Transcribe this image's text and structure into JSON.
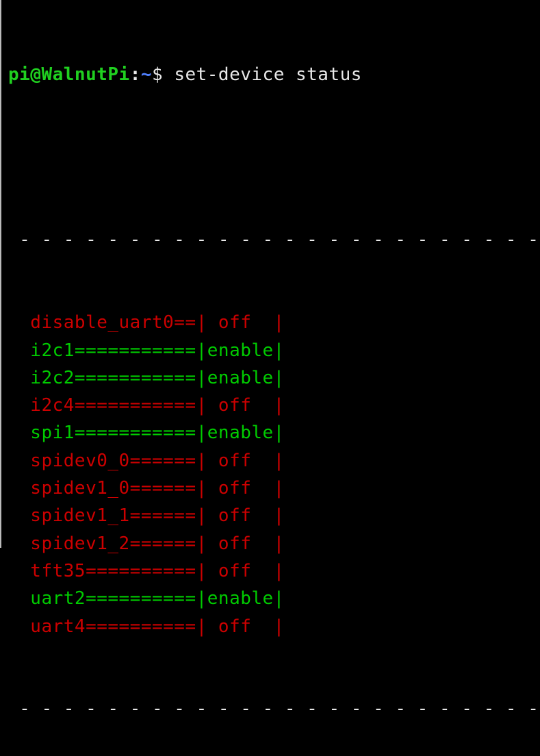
{
  "prompt": {
    "user": "pi@WalnutPi",
    "colon": ":",
    "path": "~",
    "dollar": "$",
    "command": "set-device status"
  },
  "separator": " - - - - - - - - - - - - - - - - - - - - - - - - - - - - -",
  "rows": [
    {
      "name": "disable_uart0",
      "status": "off",
      "state": "off"
    },
    {
      "name": "i2c1",
      "status": "enable",
      "state": "on"
    },
    {
      "name": "i2c2",
      "status": "enable",
      "state": "on"
    },
    {
      "name": "i2c4",
      "status": "off",
      "state": "off"
    },
    {
      "name": "spi1",
      "status": "enable",
      "state": "on"
    },
    {
      "name": "spidev0_0",
      "status": "off",
      "state": "off"
    },
    {
      "name": "spidev1_0",
      "status": "off",
      "state": "off"
    },
    {
      "name": "spidev1_1",
      "status": "off",
      "state": "off"
    },
    {
      "name": "spidev1_2",
      "status": "off",
      "state": "off"
    },
    {
      "name": "tft35",
      "status": "off",
      "state": "off"
    },
    {
      "name": "uart2",
      "status": "enable",
      "state": "on"
    },
    {
      "name": "uart4",
      "status": "off",
      "state": "off"
    }
  ],
  "colors": {
    "off": "#cc0000",
    "on": "#00cc00",
    "text": "#e8e8e8"
  },
  "nameWidth": 14,
  "statusWidth": 6
}
